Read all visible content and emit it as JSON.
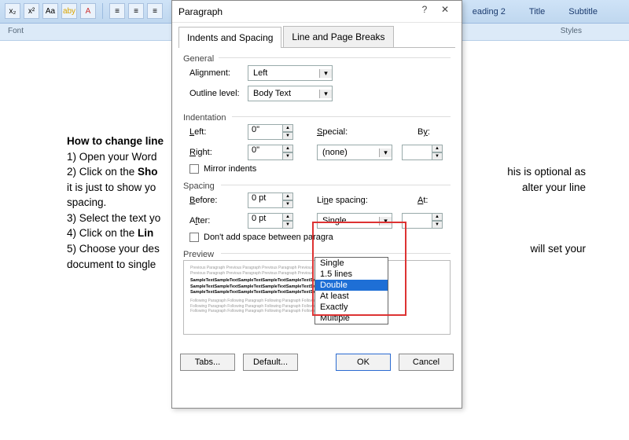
{
  "ribbon": {
    "font_group_label": "Font",
    "styles_group_label": "Styles",
    "style_items": [
      "eading 2",
      "Title",
      "Subtitle"
    ],
    "tb_icons": [
      "x₂",
      "x²",
      "Aa",
      "aby",
      "A"
    ]
  },
  "document": {
    "heading": "How to change line",
    "l1": "1) Open your Word",
    "l2a": "2) Click on the ",
    "l2b": "Sho",
    "l2c": "his is optional as",
    "l3": "it is just to show yo",
    "l3r": "alter your line",
    "l4": "spacing.",
    "l5": "3) Select the text yo",
    "l6a": "4) Click on the ",
    "l6b": "Lin",
    "l7": "5) Choose your des",
    "l7r": "will set your",
    "l8": "document to single"
  },
  "dialog": {
    "title": "Paragraph",
    "help": "?",
    "close": "✕",
    "tabs": {
      "indents": "Indents and Spacing",
      "breaks": "Line and Page Breaks"
    },
    "general": {
      "legend": "General",
      "alignment_label": "Alignment:",
      "alignment_value": "Left",
      "outline_label": "Outline level:",
      "outline_value": "Body Text"
    },
    "indent": {
      "legend": "Indentation",
      "left_label": "Left:",
      "left_value": "0\"",
      "right_label": "Right:",
      "right_value": "0\"",
      "special_label": "Special:",
      "special_value": "(none)",
      "by_label": "By:",
      "mirror": "Mirror indents"
    },
    "spacing": {
      "legend": "Spacing",
      "before_label": "Before:",
      "before_value": "0 pt",
      "after_label": "After:",
      "after_value": "0 pt",
      "line_label": "Line spacing:",
      "line_value": "Single",
      "at_label": "At:",
      "nospace": "Don't add space between paragra"
    },
    "ls_options": [
      "Single",
      "1.5 lines",
      "Double",
      "At least",
      "Exactly",
      "Multiple"
    ],
    "ls_highlighted": 2,
    "preview_legend": "Preview",
    "preview_text_grey": "Previous Paragraph Previous Paragraph Previous Paragraph Previous",
    "preview_text_bold": "SampleTextSampleTextSampleTextSampleTextSampleTextSampleTextSampleText",
    "preview_text_follow": "Following Paragraph Following Paragraph Following Paragraph Following",
    "buttons": {
      "tabs": "Tabs...",
      "default": "Default...",
      "ok": "OK",
      "cancel": "Cancel"
    }
  }
}
